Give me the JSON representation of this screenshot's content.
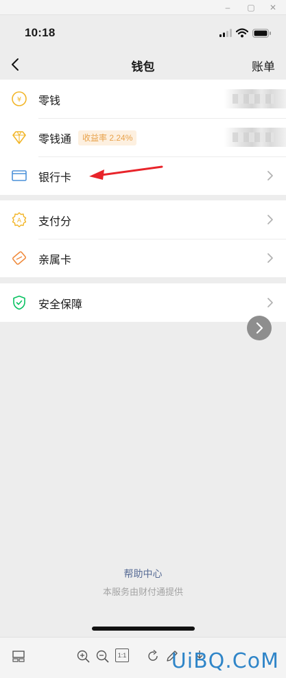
{
  "status_bar": {
    "time": "10:18"
  },
  "nav": {
    "title": "钱包",
    "right_label": "账单"
  },
  "groups": [
    {
      "rows": [
        {
          "label": "零钱",
          "icon": "yuan-coin-icon",
          "value_hidden": true
        },
        {
          "label": "零钱通",
          "icon": "diamond-icon",
          "badge": "收益率 2.24%",
          "value_hidden": true
        },
        {
          "label": "银行卡",
          "icon": "bank-card-icon"
        }
      ]
    },
    {
      "rows": [
        {
          "label": "支付分",
          "icon": "score-badge-icon"
        },
        {
          "label": "亲属卡",
          "icon": "family-card-icon"
        }
      ]
    },
    {
      "rows": [
        {
          "label": "安全保障",
          "icon": "shield-check-icon"
        }
      ]
    }
  ],
  "footer": {
    "help_link": "帮助中心",
    "provider_note": "本服务由财付通提供"
  },
  "viewer_toolbar": {
    "zoom_ratio_label": "1:1"
  },
  "watermark": "UiBQ.CoM",
  "colors": {
    "accent_link": "#576b95",
    "badge_text": "#e8a24b",
    "annotation_arrow": "#e8242a",
    "shield": "#07c160",
    "icon_yellow": "#f2b527",
    "icon_orange": "#f08a3c"
  }
}
